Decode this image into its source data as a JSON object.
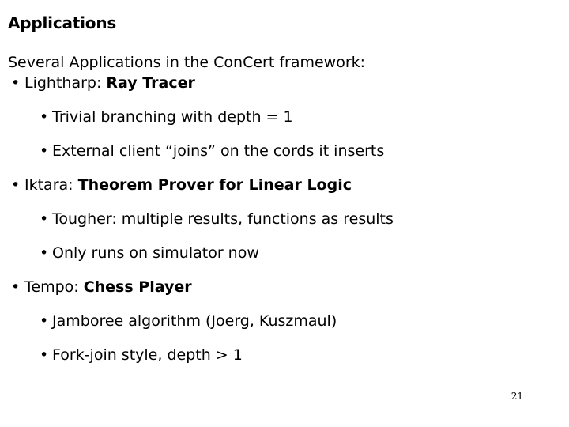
{
  "slide": {
    "title": "Applications",
    "intro": "Several Applications in the ConCert framework:",
    "page_number": "21",
    "bullet_glyph": "•",
    "text_color": "#000000",
    "background_color": "#ffffff",
    "bullets": [
      {
        "level": 1,
        "plain": "Lightharp: ",
        "bold": "Ray Tracer",
        "tail": ""
      },
      {
        "level": 2,
        "plain": "Trivial branching with depth = 1",
        "bold": "",
        "tail": ""
      },
      {
        "level": 2,
        "plain": "External client “joins” on the cords it inserts",
        "bold": "",
        "tail": ""
      },
      {
        "level": 1,
        "plain": "Iktara: ",
        "bold": "Theorem Prover for Linear Logic",
        "tail": ""
      },
      {
        "level": 2,
        "plain": "Tougher: multiple results, functions as results",
        "bold": "",
        "tail": ""
      },
      {
        "level": 2,
        "plain": "Only runs on simulator now",
        "bold": "",
        "tail": ""
      },
      {
        "level": 1,
        "plain": "Tempo: ",
        "bold": "Chess Player",
        "tail": ""
      },
      {
        "level": 2,
        "plain": "Jamboree algorithm (Joerg, Kuszmaul)",
        "bold": "",
        "tail": ""
      },
      {
        "level": 2,
        "plain": "Fork-join style, depth > 1",
        "bold": "",
        "tail": ""
      }
    ]
  }
}
